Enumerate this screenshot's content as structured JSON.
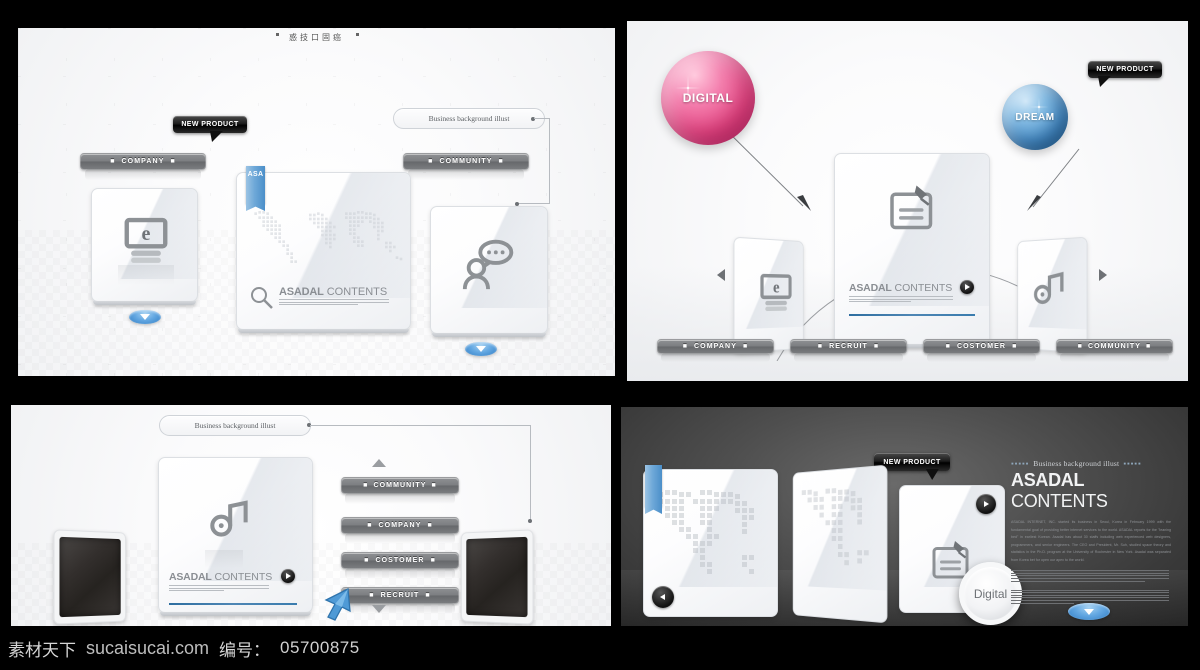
{
  "footer": {
    "site_cjk": "素材天下",
    "domain": "sucaisucai.com",
    "label_cjk": "编号：",
    "number": "05700875"
  },
  "brand": {
    "name_bold": "ASADAL",
    "name_light": "CONTENTS",
    "ribbon_label": "ASA",
    "tagline": "Business background illust",
    "body_copy": "ASADAL INTERNET, INC. started its business in Seoul, Korea in February 1999 with the fundamental goal of providing better internet services to the world. ASADAL reports for the \"leaning bed\" in earliest Korean. Asadal has about 30 staffs including web experienced web designers, programmers, and senior engineers. The CEO and President, Mr. Suh, studied space theory and statistics in the Ph.D. program at the University of Rochester in New York. Asadal was separated from Korea bet for open our apex to the world."
  },
  "panels": [
    {
      "id": "panel-1",
      "title_cjk": "惑技口固癌",
      "badge": "NEW PRODUCT",
      "callout": "Business background illust",
      "nav": [
        "COMPANY",
        "COMMUNITY"
      ],
      "card_title_bold": "ASADAL",
      "card_title_light": "CONTENTS",
      "ribbon": "ASA",
      "icons": [
        "monitor-e-icon",
        "world-map-icon",
        "chat-person-icon"
      ]
    },
    {
      "id": "panel-2",
      "badge": "NEW PRODUCT",
      "spheres": [
        {
          "label": "DIGITAL",
          "color": "#f0699b"
        },
        {
          "label": "DREAM",
          "color": "#5fa2d6"
        }
      ],
      "nav": [
        "COMPANY",
        "RECRUIT",
        "COSTOMER",
        "COMMUNITY"
      ],
      "card_title_bold": "ASADAL",
      "card_title_light": "CONTENTS",
      "icons": [
        "monitor-e-icon",
        "note-pin-icon",
        "music-note-icon"
      ],
      "arrows": [
        "prev",
        "next"
      ]
    },
    {
      "id": "panel-3",
      "callout": "Business background illust",
      "nav": [
        "COMMUNITY",
        "COMPANY",
        "COSTOMER",
        "RECRUIT"
      ],
      "card_title_bold": "ASADAL",
      "card_title_light": "CONTENTS",
      "icons": [
        "music-note-icon"
      ],
      "arrows": [
        "up",
        "down"
      ]
    },
    {
      "id": "panel-4",
      "badge": "NEW PRODUCT",
      "tagline": "Business background illust",
      "title_bold": "ASADAL",
      "title_light": "CONTENTS",
      "circle_label": "Digital",
      "icons": [
        "world-map-icon",
        "note-pin-icon"
      ],
      "arrows": [
        "prev",
        "play",
        "down"
      ]
    }
  ],
  "colors": {
    "pink_sphere": "#f0699b",
    "blue_sphere": "#5fa2d6",
    "ribbon_blue": "#5f9bd1",
    "nav_grey": "#7c7e81",
    "dark_panel": "#4a4a4a",
    "accent_line": "#3a7cae"
  }
}
